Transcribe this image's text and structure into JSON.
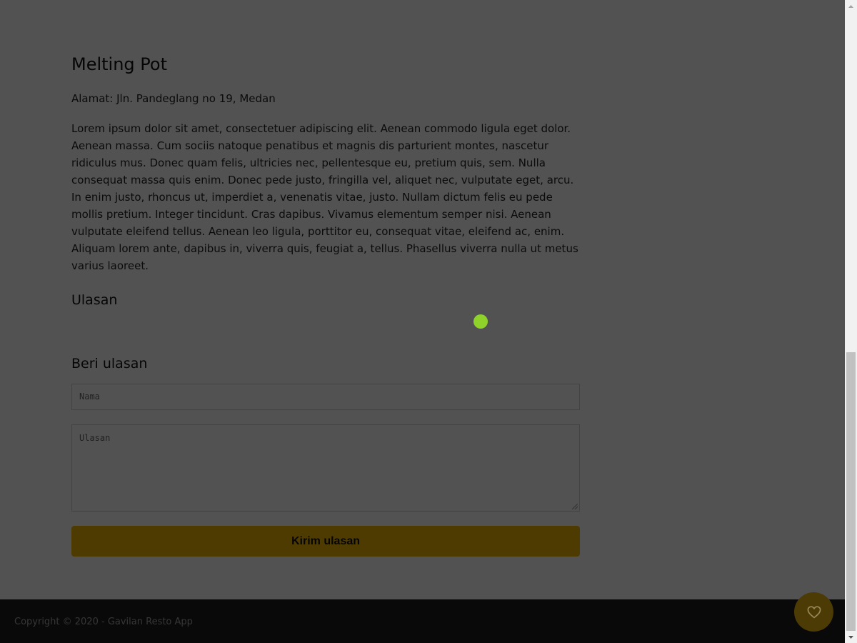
{
  "restaurant": {
    "name": "Melting Pot",
    "address": "Alamat: Jln. Pandeglang no 19, Medan",
    "description": "Lorem ipsum dolor sit amet, consectetuer adipiscing elit. Aenean commodo ligula eget dolor. Aenean massa. Cum sociis natoque penatibus et magnis dis parturient montes, nascetur ridiculus mus. Donec quam felis, ultricies nec, pellentesque eu, pretium quis, sem. Nulla consequat massa quis enim. Donec pede justo, fringilla vel, aliquet nec, vulputate eget, arcu. In enim justo, rhoncus ut, imperdiet a, venenatis vitae, justo. Nullam dictum felis eu pede mollis pretium. Integer tincidunt. Cras dapibus. Vivamus elementum semper nisi. Aenean vulputate eleifend tellus. Aenean leo ligula, porttitor eu, consequat vitae, eleifend ac, enim. Aliquam lorem ante, dapibus in, viverra quis, feugiat a, tellus. Phasellus viverra nulla ut metus varius laoreet."
  },
  "reviews": {
    "heading": "Ulasan"
  },
  "review_form": {
    "heading": "Beri ulasan",
    "name_placeholder": "Nama",
    "review_placeholder": "Ulasan",
    "submit_label": "Kirim ulasan"
  },
  "footer": {
    "copyright": "Copyright © 2020 - Gavilan Resto App"
  },
  "favorite_button": {
    "icon": "heart-outline-icon"
  },
  "colors": {
    "accent": "#f2b706",
    "footer_bg": "#1c1c1c",
    "overlay": "rgba(0,0,0,0.68)",
    "cursor_dot": "#8fd22a"
  }
}
